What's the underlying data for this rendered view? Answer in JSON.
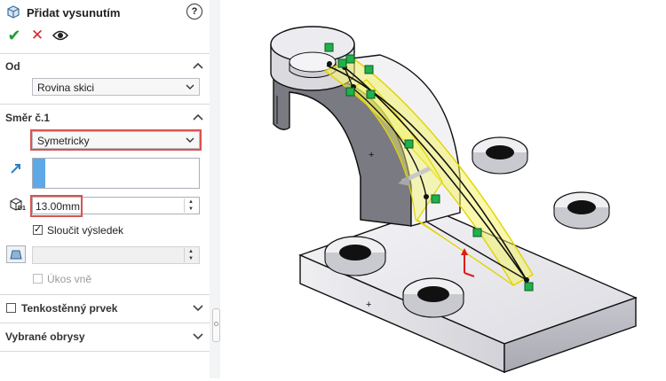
{
  "panel": {
    "title": "Přidat vysunutím",
    "help_glyph": "?",
    "actions": {
      "ok_glyph": "✔",
      "cancel_glyph": "✕"
    },
    "od": {
      "label": "Od",
      "select_value": "Rovina skici"
    },
    "smer": {
      "label": "Směr č.1",
      "end_condition_value": "Symetricky",
      "depth_value": "13.00mm",
      "depth_prefix": "D1",
      "merge_label": "Sloučit výsledek",
      "merge_checked": true,
      "draft_label": "Úkos vně",
      "draft_checked": false
    },
    "thin_feature": {
      "label": "Tenkostěnný prvek",
      "checked": false
    },
    "selected_contours": {
      "label": "Vybrané obrysy"
    }
  },
  "colors": {
    "accent_blue": "#5ea8e8",
    "highlight_red": "#d9534f",
    "ok_green": "#1e9b3a",
    "cancel_red": "#d6262b",
    "preview_yellow": "#f4f36a",
    "marker_green": "#1fb14a"
  }
}
